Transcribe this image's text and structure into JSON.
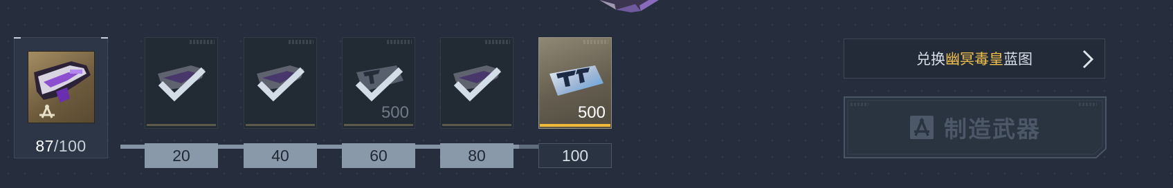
{
  "progress": {
    "current": "87",
    "separator": "/",
    "max": "100",
    "fraction": 0.87
  },
  "milestones": [
    {
      "threshold": "20",
      "reward_type": "weapon-fragment",
      "claimed": true,
      "reward_amount": ""
    },
    {
      "threshold": "40",
      "reward_type": "weapon-fragment",
      "claimed": true,
      "reward_amount": ""
    },
    {
      "threshold": "60",
      "reward_type": "ticket",
      "claimed": true,
      "reward_amount": "500"
    },
    {
      "threshold": "80",
      "reward_type": "weapon-fragment",
      "claimed": true,
      "reward_amount": ""
    },
    {
      "threshold": "100",
      "reward_type": "ticket",
      "claimed": false,
      "reward_amount": "500"
    }
  ],
  "exchange_button": {
    "prefix": "兑换",
    "highlight": "幽冥毒皇",
    "suffix": "蓝图",
    "icon": "chevron-right-icon"
  },
  "craft_button": {
    "label": "制造武器",
    "icon": "blueprint-compass-icon",
    "enabled": false
  },
  "colors": {
    "background": "#262e3d",
    "accent_gold": "#f2c04b",
    "threshold_reached": "#8a99aa",
    "disabled_text": "#4c5767"
  }
}
